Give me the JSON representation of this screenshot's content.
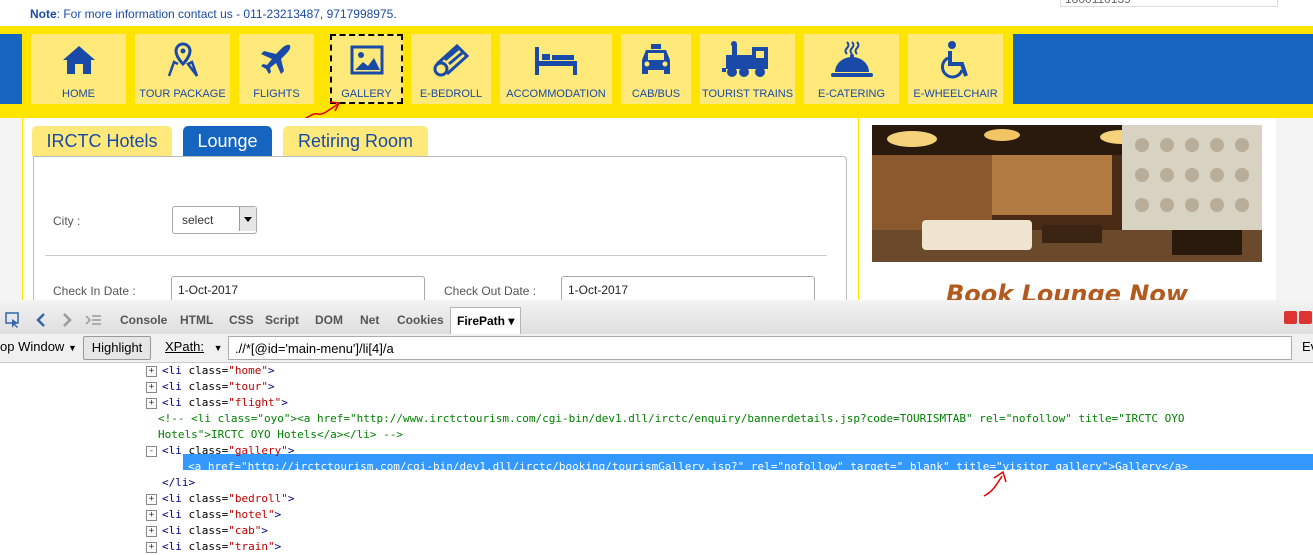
{
  "note": {
    "label": "Note",
    "text": ": For more information contact us - 011-23213487, 9717998975."
  },
  "phone_fragment": "1800110139",
  "menu": [
    {
      "key": "home",
      "label": "HOME",
      "icon": "home-icon"
    },
    {
      "key": "tour",
      "label": "TOUR PACKAGE",
      "icon": "map-pin-icon"
    },
    {
      "key": "flight",
      "label": "FLIGHTS",
      "icon": "airplane-icon"
    },
    {
      "key": "gallery",
      "label": "GALLERY",
      "icon": "image-icon"
    },
    {
      "key": "bedroll",
      "label": "E-BEDROLL",
      "icon": "bedroll-icon"
    },
    {
      "key": "hotel",
      "label": "ACCOMMODATION",
      "icon": "bed-icon"
    },
    {
      "key": "cab",
      "label": "CAB/BUS",
      "icon": "taxi-icon"
    },
    {
      "key": "train",
      "label": "TOURIST TRAINS",
      "icon": "train-icon"
    },
    {
      "key": "catering",
      "label": "E-CATERING",
      "icon": "food-cloche-icon"
    },
    {
      "key": "wheelchair",
      "label": "E-WHEELCHAIR",
      "icon": "wheelchair-icon"
    }
  ],
  "tabs": [
    {
      "label": "IRCTC Hotels",
      "active": false
    },
    {
      "label": "Lounge",
      "active": true
    },
    {
      "label": "Retiring Room",
      "active": false
    }
  ],
  "form": {
    "city_label": "City :",
    "city_value": "select",
    "checkin_label": "Check In Date :",
    "checkin_value": "1-Oct-2017",
    "checkout_label": "Check Out Date :",
    "checkout_value": "1-Oct-2017"
  },
  "side": {
    "book_text": "Book Lounge Now"
  },
  "firebug": {
    "tabs": [
      "Console",
      "HTML",
      "CSS",
      "Script",
      "DOM",
      "Net",
      "Cookies",
      "FirePath"
    ],
    "selected_tab": "FirePath",
    "window_mode": "op Window",
    "highlight_label": "Highlight",
    "xpath_label": "XPath:",
    "xpath_value": ".//*[@id='main-menu']/li[4]/a",
    "right_fragment": "Ev"
  },
  "code_lines": [
    {
      "type": "li",
      "cls": "home",
      "tw": "+"
    },
    {
      "type": "li",
      "cls": "tour",
      "tw": "+"
    },
    {
      "type": "li",
      "cls": "flight",
      "tw": "+"
    },
    {
      "type": "comment",
      "text": "<!-- <li class=\"oyo\"><a href=\"http://www.irctctourism.com/cgi-bin/dev1.dll/irctc/enquiry/bannerdetails.jsp?code=TOURISMTAB\" rel=\"nofollow\" title=\"IRCTC OYO"
    },
    {
      "type": "comment2",
      "text": "Hotels\">IRCTC OYO Hotels</a></li> -->"
    },
    {
      "type": "li",
      "cls": "gallery",
      "tw": "-"
    },
    {
      "type": "a_selected",
      "text": "<a href=\"http://irctctourism.com/cgi-bin/dev1.dll/irctc/booking/tourismGallery.jsp?\" rel=\"nofollow\" target=\"_blank\" title=\"visitor gallery\">Gallery</a>"
    },
    {
      "type": "close",
      "text": "</li>"
    },
    {
      "type": "li",
      "cls": "bedroll",
      "tw": "+"
    },
    {
      "type": "li",
      "cls": "hotel",
      "tw": "+"
    },
    {
      "type": "li",
      "cls": "cab",
      "tw": "+"
    },
    {
      "type": "li",
      "cls": "train",
      "tw": "+"
    }
  ]
}
